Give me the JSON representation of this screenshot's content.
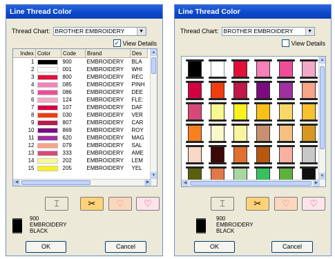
{
  "left": {
    "title": "Line Thread Color",
    "thread_chart_label": "Thread Chart:",
    "thread_chart_value": "BROTHER EMBROIDERY",
    "view_details_label": "View Details",
    "view_details_checked": true,
    "columns": [
      "Index",
      "Color",
      "Code",
      "Brand",
      "Des"
    ],
    "rows": [
      {
        "index": "1",
        "color": "#000000",
        "code": "900",
        "brand": "EMBROIDERY",
        "desc": "BLA"
      },
      {
        "index": "2",
        "color": "#ffffff",
        "code": "001",
        "brand": "EMBROIDERY",
        "desc": "WHI"
      },
      {
        "index": "3",
        "color": "#e0103a",
        "code": "800",
        "brand": "EMBROIDERY",
        "desc": "REC"
      },
      {
        "index": "4",
        "color": "#f680b8",
        "code": "085",
        "brand": "EMBROIDERY",
        "desc": "PINH"
      },
      {
        "index": "5",
        "color": "#f04c98",
        "code": "086",
        "brand": "EMBROIDERY",
        "desc": "DEE"
      },
      {
        "index": "6",
        "color": "#f4a8c8",
        "code": "124",
        "brand": "EMBROIDERY",
        "desc": "FLE:"
      },
      {
        "index": "7",
        "color": "#d40040",
        "code": "107",
        "brand": "EMBROIDERY",
        "desc": "DAF"
      },
      {
        "index": "8",
        "color": "#f03c10",
        "code": "030",
        "brand": "EMBROIDERY",
        "desc": "VER"
      },
      {
        "index": "9",
        "color": "#c01848",
        "code": "807",
        "brand": "EMBROIDERY",
        "desc": "CAR"
      },
      {
        "index": "10",
        "color": "#7a0c80",
        "code": "869",
        "brand": "EMBROIDERY",
        "desc": "ROY"
      },
      {
        "index": "11",
        "color": "#a030a0",
        "code": "620",
        "brand": "EMBROIDERY",
        "desc": "MAG"
      },
      {
        "index": "12",
        "color": "#f8a488",
        "code": "079",
        "brand": "EMBROIDERY",
        "desc": "SAL"
      },
      {
        "index": "13",
        "color": "#d84878",
        "code": "333",
        "brand": "EMBROIDERY",
        "desc": "AME"
      },
      {
        "index": "14",
        "color": "#f8f890",
        "code": "202",
        "brand": "EMBROIDERY",
        "desc": "LEM"
      },
      {
        "index": "15",
        "color": "#f8f020",
        "code": "205",
        "brand": "EMBROIDERY",
        "desc": "YEL"
      }
    ],
    "selected_code": "900",
    "selected_brand": "EMBROIDERY",
    "selected_name": "BLACK",
    "selected_color": "#000000",
    "ok_label": "OK",
    "cancel_label": "Cancel"
  },
  "right": {
    "title": "Line Thread Color",
    "thread_chart_label": "Thread Chart:",
    "thread_chart_value": "BROTHER EMBROIDERY",
    "view_details_label": "View Details",
    "view_details_checked": false,
    "spools": [
      [
        "#000000",
        "#ffffff",
        "#e0103a",
        "#f680b8",
        "#f04c98",
        "#f4a8c8"
      ],
      [
        "#d40040",
        "#f03c10",
        "#c01848",
        "#7a0c80",
        "#a030a0",
        "#f8a488"
      ],
      [
        "#d84878",
        "#f8f890",
        "#f8f020",
        "#f8c018",
        "#f8d868",
        "#f8c030"
      ],
      [
        "#f88020",
        "#f8f8c8",
        "#f8f4a0",
        "#c89070",
        "#f8c080",
        "#d89820"
      ],
      [
        "#f8d8c8",
        "#3c0808",
        "#e07030",
        "#b85810",
        "#f8b0a0",
        "#c8c8c8"
      ],
      [
        "#5a6010",
        "#e07848",
        "#a8d8a0",
        "#38c060",
        "#60b040",
        "#101010"
      ]
    ],
    "selected_code": "900",
    "selected_brand": "EMBROIDERY",
    "selected_name": "BLACK",
    "selected_color": "#000000",
    "ok_label": "OK",
    "cancel_label": "Cancel"
  },
  "tools": {
    "spool_icon": "spool-icon",
    "scissors_icon": "scissors-heart-icon",
    "heart_outline_icon": "heart-outline-icon",
    "heart_solid_icon": "heart-icon"
  }
}
